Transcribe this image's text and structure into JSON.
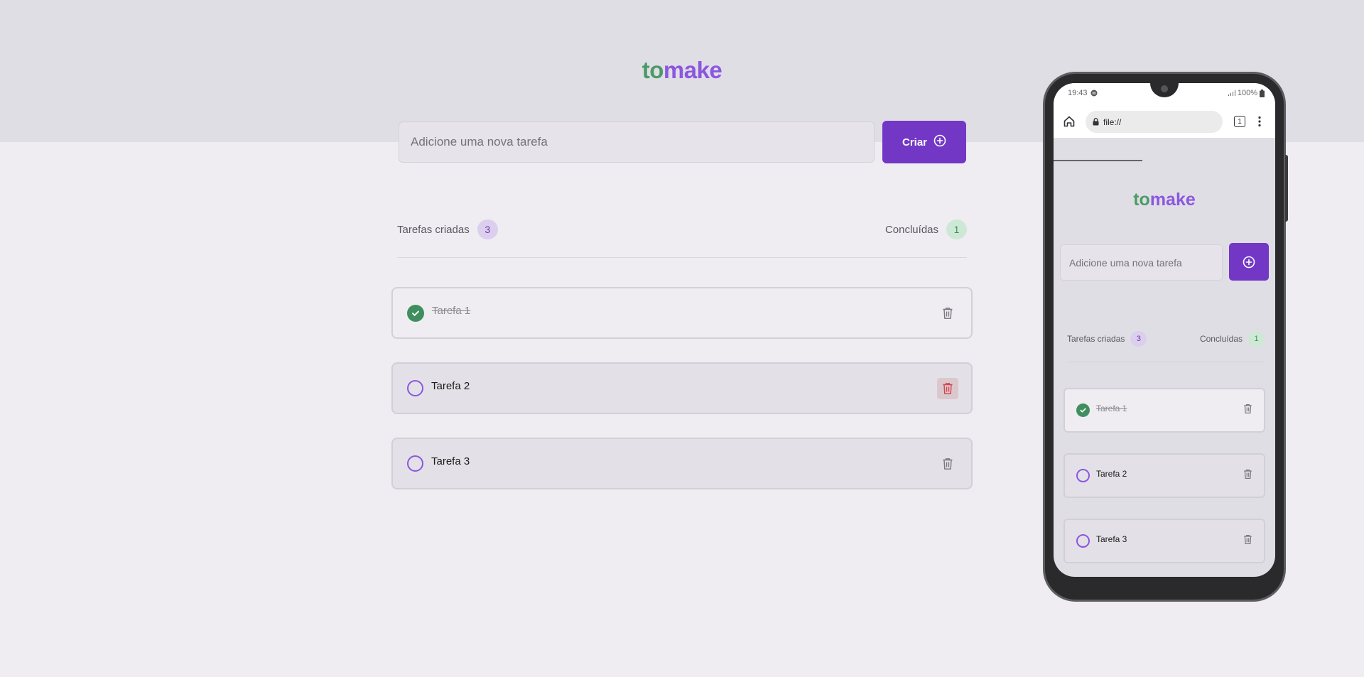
{
  "app": {
    "logo_to": "to",
    "logo_make": "make"
  },
  "form": {
    "input_placeholder": "Adicione uma nova tarefa",
    "input_value": "",
    "create_label": "Criar"
  },
  "counters": {
    "created_label": "Tarefas criadas",
    "created_count": "3",
    "done_label": "Concluídas",
    "done_count": "1"
  },
  "tasks": [
    {
      "text": "Tarefa 1",
      "completed": true
    },
    {
      "text": "Tarefa 2",
      "completed": false
    },
    {
      "text": "Tarefa 3",
      "completed": false
    }
  ],
  "phone": {
    "time": "19:43",
    "battery": "100%",
    "url": "file://",
    "tab_count": "1"
  },
  "colors": {
    "green": "#4b9b67",
    "purple": "#8b57e0",
    "button": "#7337c6"
  },
  "icons": [
    "plus-circle-icon",
    "check-icon",
    "trash-icon",
    "home-icon",
    "lock-icon",
    "more-vert-icon",
    "signal-icon",
    "battery-icon"
  ]
}
